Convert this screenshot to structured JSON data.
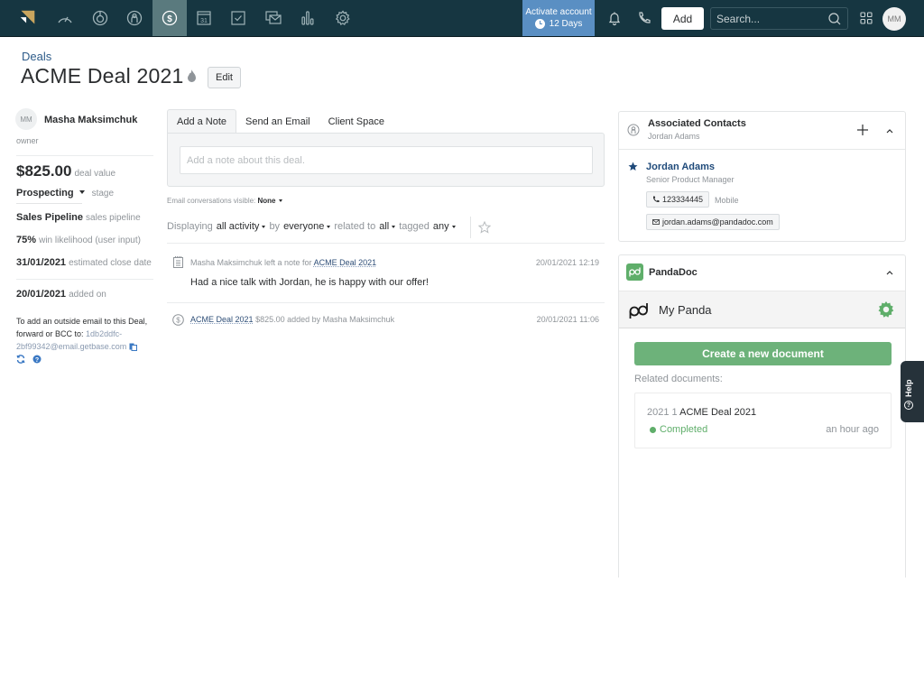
{
  "nav": {
    "icons": [
      "logo",
      "dashboard-icon",
      "leads-icon",
      "contacts-icon",
      "deals-icon",
      "calendar-icon",
      "tasks-icon",
      "communications-icon",
      "reports-icon",
      "settings-icon"
    ],
    "active": "deals-icon",
    "calendar_day": "31",
    "activate": {
      "label": "Activate account",
      "days": "12 Days"
    },
    "add_label": "Add",
    "search_placeholder": "Search...",
    "avatar_initials": "MM"
  },
  "header": {
    "breadcrumb": "Deals",
    "title": "ACME Deal 2021",
    "edit_label": "Edit"
  },
  "sidebar": {
    "owner": {
      "initials": "MM",
      "name": "Masha Maksimchuk",
      "label": "owner"
    },
    "value": {
      "amount": "$825.00",
      "label": "deal value"
    },
    "stage": {
      "value": "Prospecting",
      "label": "stage"
    },
    "pipeline": {
      "value": "Sales Pipeline",
      "label": "sales pipeline"
    },
    "likelihood": {
      "value": "75%",
      "label": "win likelihood (user input)"
    },
    "close_date": {
      "value": "31/01/2021",
      "label": "estimated close date"
    },
    "added_on": {
      "value": "20/01/2021",
      "label": "added on"
    },
    "email_info": {
      "text": "To add an outside email to this Deal, forward or BCC to:",
      "address": "1db2ddfc-2bf99342@email.getbase.com"
    }
  },
  "composer": {
    "tabs": [
      "Add a Note",
      "Send an Email",
      "Client Space"
    ],
    "active_tab": 0,
    "note_placeholder": "Add a note about this deal.",
    "email_visible_label": "Email conversations visible:",
    "email_visible_value": "None"
  },
  "filters": {
    "displaying": "Displaying",
    "activity": "all activity",
    "by": "by",
    "who": "everyone",
    "related": "related to",
    "related_value": "all",
    "tagged": "tagged",
    "tagged_value": "any"
  },
  "activity": [
    {
      "icon": "note-icon",
      "actor": "Masha Maksimchuk left a note for",
      "link": "ACME Deal 2021",
      "time": "20/01/2021 12:19",
      "body": "Had a nice talk with Jordan, he is happy with our offer!"
    },
    {
      "icon": "deal-icon",
      "link": "ACME Deal 2021",
      "actor": "$825.00 added by Masha Maksimchuk",
      "time": "20/01/2021 11:06"
    }
  ],
  "contacts": {
    "title": "Associated Contacts",
    "subtitle": "Jordan Adams",
    "contact": {
      "name": "Jordan Adams",
      "job_title": "Senior Product Manager",
      "phone": "123334445",
      "phone_type": "Mobile",
      "email": "jordan.adams@pandadoc.com"
    }
  },
  "pandadoc": {
    "title": "PandaDoc",
    "workspace": "My Panda",
    "create_label": "Create a new document",
    "related_label": "Related documents:",
    "documents": [
      {
        "prefix": "2021 1",
        "name": "ACME Deal 2021",
        "status": "Completed",
        "time": "an hour ago"
      }
    ],
    "brand_color": "#5fae6a"
  },
  "help": {
    "label": "Help"
  }
}
